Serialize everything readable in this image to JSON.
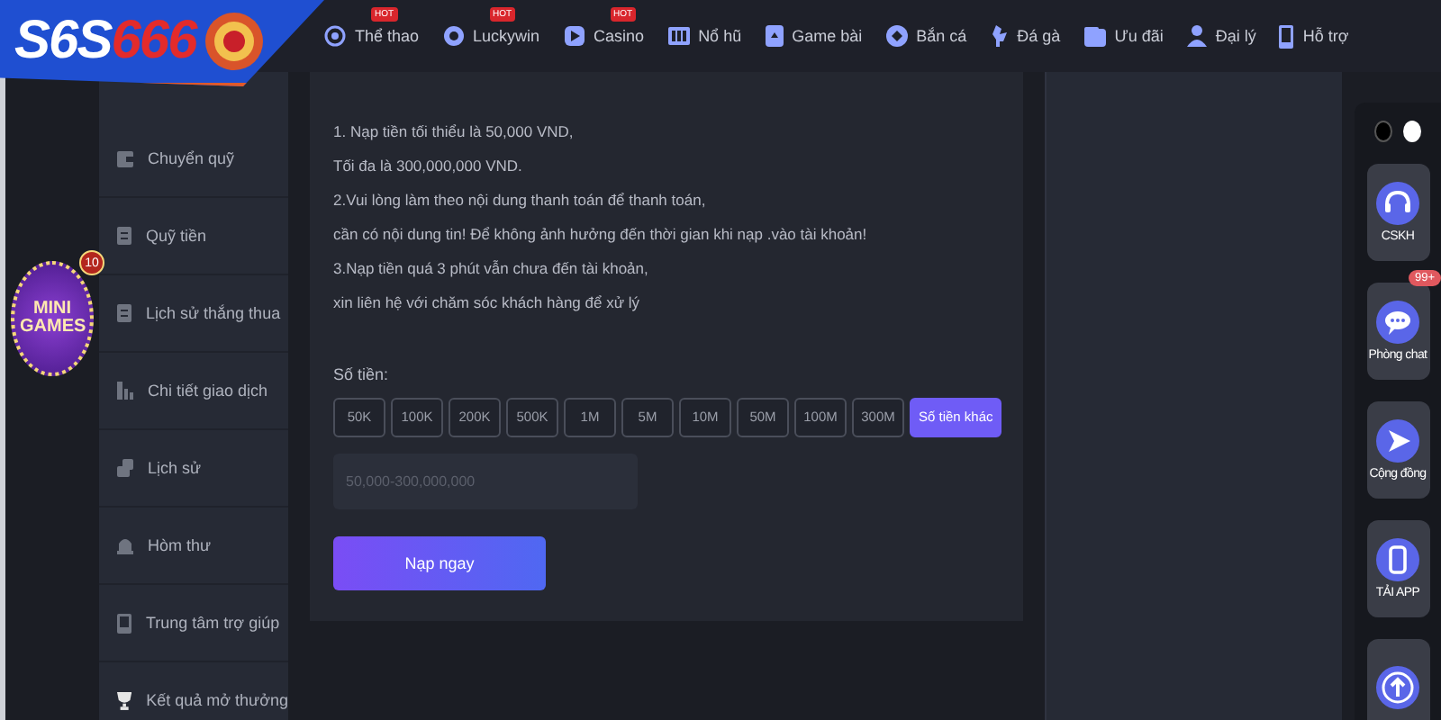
{
  "logo": {
    "part_a": "S6S",
    "part_b": "666"
  },
  "nav": [
    {
      "label": "Thể thao",
      "badge": "HOT"
    },
    {
      "label": "Luckywin",
      "badge": "HOT"
    },
    {
      "label": "Casino",
      "badge": "HOT"
    },
    {
      "label": "Nổ hũ"
    },
    {
      "label": "Game bài"
    },
    {
      "label": "Bắn cá"
    },
    {
      "label": "Đá gà"
    },
    {
      "label": "Ưu đãi"
    },
    {
      "label": "Đại lý"
    },
    {
      "label": "Hỗ trợ"
    }
  ],
  "mini_games": {
    "title": "MINI GAMES",
    "count": "10"
  },
  "sidebar": {
    "items": [
      {
        "label": "Chuyển quỹ"
      },
      {
        "label": "Quỹ tiền"
      },
      {
        "label": "Lịch sử thắng thua"
      },
      {
        "label": "Chi tiết giao dịch"
      },
      {
        "label": "Lịch sử"
      },
      {
        "label": "Hòm thư"
      },
      {
        "label": "Trung tâm trợ giúp"
      },
      {
        "label": "Kết quả mở thưởng"
      }
    ]
  },
  "deposit": {
    "notes": [
      "1. Nạp tiền tối thiểu là 50,000 VND,",
      "Tối đa là 300,000,000 VND.",
      "2.Vui lòng làm theo nội dung thanh toán để thanh toán,",
      "cần có nội dung tin! Để không ảnh hưởng đến thời gian khi nạp .vào tài khoản!",
      "3.Nạp tiền quá 3 phút vẫn chưa đến tài khoản,",
      "xin liên hệ với chăm sóc khách hàng để xử lý"
    ],
    "amount_label": "Số tiền:",
    "amounts": [
      {
        "label": "50K",
        "selected": false
      },
      {
        "label": "100K",
        "selected": false
      },
      {
        "label": "200K",
        "selected": false
      },
      {
        "label": "500K",
        "selected": false
      },
      {
        "label": "1M",
        "selected": false
      },
      {
        "label": "5M",
        "selected": false
      },
      {
        "label": "10M",
        "selected": false
      },
      {
        "label": "50M",
        "selected": false
      },
      {
        "label": "100M",
        "selected": false
      },
      {
        "label": "300M",
        "selected": false
      },
      {
        "label": "Số tiền khác",
        "selected": true
      }
    ],
    "amount_field": {
      "placeholder": "50,000-300,000,000"
    },
    "submit": "Nạp ngay"
  },
  "theme_toggle": [
    {
      "color": "#000000",
      "selected": false
    },
    {
      "color": "#ffffff",
      "selected": true
    }
  ],
  "quick_actions": [
    {
      "label": "CSKH"
    },
    {
      "label": "Phòng chat",
      "badge": "99+"
    },
    {
      "label": "Cộng đồng"
    },
    {
      "label": "TẢI APP"
    },
    {
      "kind": "scroll_top"
    }
  ]
}
